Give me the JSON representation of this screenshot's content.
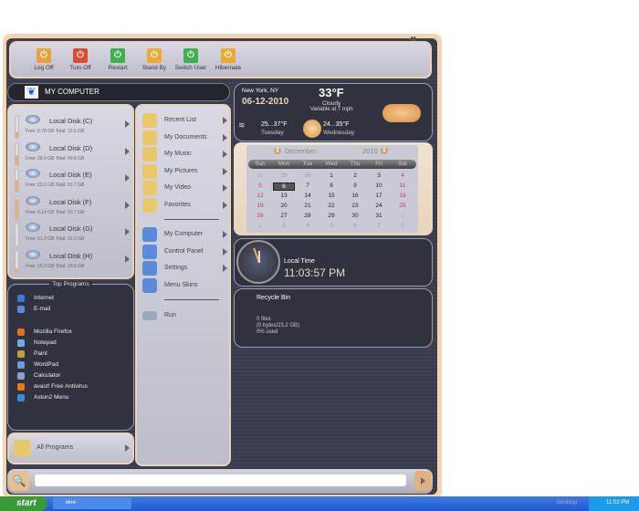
{
  "toolbar": {
    "buttons": [
      {
        "label": "Log Off",
        "icon": "key-icon",
        "color": "#e8a23a"
      },
      {
        "label": "Turn Off",
        "icon": "power-icon",
        "color": "#e04a30"
      },
      {
        "label": "Restart",
        "icon": "restart-icon",
        "color": "#3bb24a"
      },
      {
        "label": "Stand By",
        "icon": "standby-icon",
        "color": "#f0a830"
      },
      {
        "label": "Switch User",
        "icon": "switch-user-icon",
        "color": "#3bb24a"
      },
      {
        "label": "Hibernate",
        "icon": "hibernate-icon",
        "color": "#f0a830"
      }
    ]
  },
  "header": {
    "title": "MY COMPUTER"
  },
  "disks": [
    {
      "name": "Local Disk (C)",
      "info": "Free: 8.78 GB Total: 12.6 GB",
      "used_percent": 30
    },
    {
      "name": "Local Disk (D)",
      "info": "Free: 28.9 GB Total: 49.8 GB",
      "used_percent": 42
    },
    {
      "name": "Local Disk (E)",
      "info": "Free: 23.1 GB Total: 51.7 GB",
      "used_percent": 55
    },
    {
      "name": "Local Disk (F)",
      "info": "Free: 6.14 GB Total: 50.7 GB",
      "used_percent": 88
    },
    {
      "name": "Local Disk (G)",
      "info": "Free: 51.0 GB Total: 51.2 GB",
      "used_percent": 1
    },
    {
      "name": "Local Disk (H)",
      "info": "Free: 15.2 GB Total: 18.5 GB",
      "used_percent": 18
    }
  ],
  "places": [
    {
      "label": "Recent List",
      "icon": "recent-list-icon"
    },
    {
      "label": "My Documents",
      "icon": "my-documents-icon"
    },
    {
      "label": "My Music",
      "icon": "my-music-icon"
    },
    {
      "label": "My Pictures",
      "icon": "my-pictures-icon"
    },
    {
      "label": "My Video",
      "icon": "my-video-icon"
    },
    {
      "label": "Favorites",
      "icon": "star-icon"
    }
  ],
  "system": [
    {
      "label": "My Computer",
      "icon": "my-computer-icon"
    },
    {
      "label": "Control Panel",
      "icon": "control-panel-icon"
    },
    {
      "label": "Settings",
      "icon": "settings-icon"
    },
    {
      "label": "Menu Skins",
      "icon": "menu-skins-icon"
    }
  ],
  "run": {
    "label": "Run"
  },
  "top_programs": {
    "title": "Top Programs",
    "items": [
      {
        "label": "Internet",
        "color": "#3a7ad8"
      },
      {
        "label": "E-mail",
        "color": "#5a8ad0"
      },
      {
        "label": "Mozilla Firefox",
        "color": "#e07020"
      },
      {
        "label": "Notepad",
        "color": "#6ab0e0"
      },
      {
        "label": "Paint",
        "color": "#c0a040"
      },
      {
        "label": "WordPad",
        "color": "#6a9ad8"
      },
      {
        "label": "Calculator",
        "color": "#8aa0d0"
      },
      {
        "label": "avast! Free Antivirus",
        "color": "#f07a10"
      },
      {
        "label": "Aston2 Menu",
        "color": "#3a8ad8"
      }
    ]
  },
  "all_programs": {
    "label": "All Programs"
  },
  "weather": {
    "city": "New York, NY",
    "date": "06-12-2010",
    "temp": "33°F",
    "condition": "Cloudy",
    "wind": "Variable at 7 mph",
    "forecast": [
      {
        "range": "25...37°F",
        "day": "Tuesday"
      },
      {
        "range": "24...35°F",
        "day": "Wednesday"
      }
    ]
  },
  "calendar": {
    "month": "December",
    "year": "2010",
    "days": [
      "Sun",
      "Mon",
      "Tue",
      "Wed",
      "Thu",
      "Fri",
      "Sat"
    ],
    "weeks": [
      [
        "28",
        "29",
        "30",
        "1",
        "2",
        "3",
        "4"
      ],
      [
        "5",
        "6",
        "7",
        "8",
        "9",
        "10",
        "11"
      ],
      [
        "12",
        "13",
        "14",
        "15",
        "16",
        "17",
        "18"
      ],
      [
        "19",
        "20",
        "21",
        "22",
        "23",
        "24",
        "25"
      ],
      [
        "26",
        "27",
        "28",
        "29",
        "30",
        "31",
        "1"
      ],
      [
        "2",
        "3",
        "4",
        "5",
        "6",
        "7",
        "8"
      ]
    ],
    "selected": "6"
  },
  "clock": {
    "label": "Local Time",
    "time": "11:03:57 PM"
  },
  "recycle": {
    "title": "Recycle Bin",
    "files": "0 files",
    "size": "(0 bytes/23.2 GB)",
    "used": "0% used"
  },
  "search": {
    "value": "",
    "placeholder": ""
  },
  "taskbar": {
    "start": "start",
    "task": "мнн",
    "desktop": "Desktop",
    "time": "11:03 PM"
  }
}
